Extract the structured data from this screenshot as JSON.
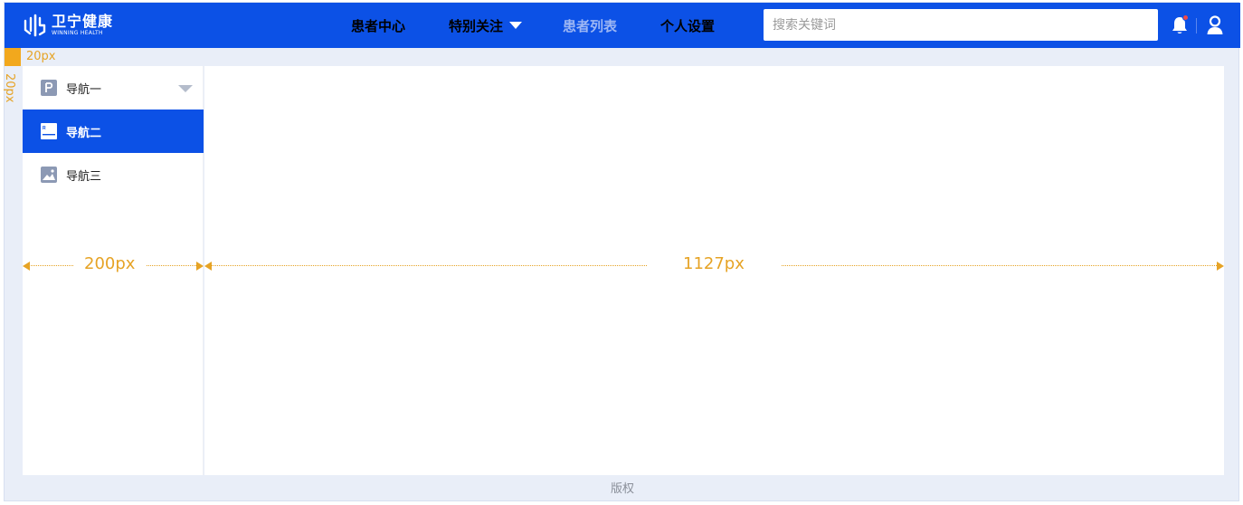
{
  "header": {
    "logo_cn": "卫宁健康",
    "logo_en": "WINNING HEALTH",
    "nav": [
      {
        "label": "患者中心",
        "state": "normal"
      },
      {
        "label": "特别关注",
        "state": "dropdown"
      },
      {
        "label": "患者列表",
        "state": "dim"
      },
      {
        "label": "个人设置",
        "state": "normal"
      }
    ],
    "search_placeholder": "搜索关键词",
    "bell_icon": "bell-icon",
    "user_icon": "user-icon",
    "colors": {
      "brand": "#0c51e6",
      "notify": "#f04848"
    }
  },
  "markers": {
    "top_label": "20px",
    "left_label": "20px",
    "sidebar_width_label": "200px",
    "main_width_label": "1127px",
    "color": "#e6a325"
  },
  "sidebar": {
    "items": [
      {
        "label": "导航一",
        "icon": "p-icon",
        "active": false,
        "expandable": true
      },
      {
        "label": "导航二",
        "icon": "document-icon",
        "active": true,
        "expandable": false
      },
      {
        "label": "导航三",
        "icon": "image-icon",
        "active": false,
        "expandable": false
      }
    ]
  },
  "footer": {
    "text": "版权"
  }
}
